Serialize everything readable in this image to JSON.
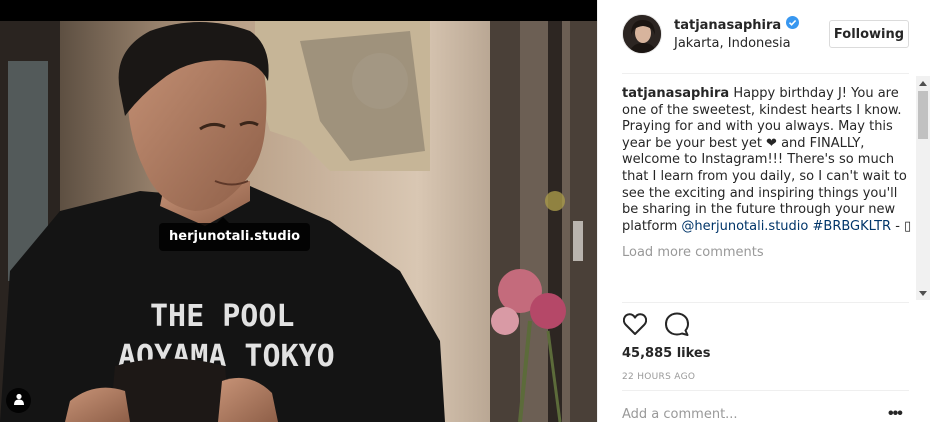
{
  "post": {
    "photo_tag": "herjunotali.studio",
    "shirt_text_line1": "THE POOL",
    "shirt_text_line2": "AOYAMA TOKYO"
  },
  "header": {
    "username": "tatjanasaphira",
    "verified_icon": "verified-badge-icon",
    "location": "Jakarta, Indonesia",
    "follow_label": "Following"
  },
  "caption": {
    "username": "tatjanasaphira",
    "text": "Happy birthday J! You are one of the sweetest, kindest hearts I know. Praying for and with you always. May this year be your best yet ❤ and FINALLY, welcome to Instagram!!! There's so much that I learn from you daily, so I can't wait to see the exciting and inspiring things you'll be sharing in the future through your new platform",
    "mention": "@herjunotali.studio",
    "hashtag": "#BRBGKLTR",
    "ending": "- ▯"
  },
  "comments": {
    "load_more_label": "Load more comments"
  },
  "actions": {
    "like_icon": "heart-icon",
    "comment_icon": "comment-icon"
  },
  "stats": {
    "likes": "45,885 likes",
    "timestamp": "22 HOURS AGO"
  },
  "comment_box": {
    "placeholder": "Add a comment...",
    "more_label": "•••"
  },
  "colors": {
    "text": "#262626",
    "muted": "#999999",
    "link": "#003569",
    "verified": "#3897f0",
    "border": "#efefef"
  }
}
